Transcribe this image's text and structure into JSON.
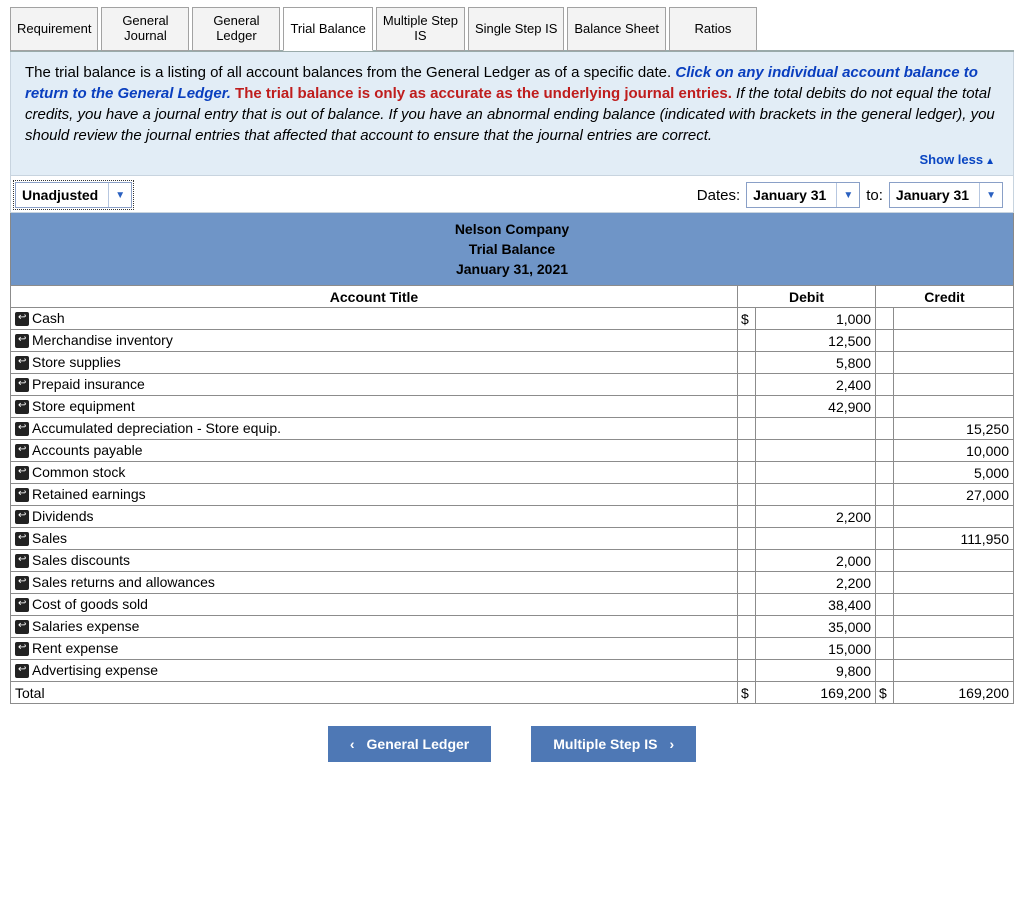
{
  "tabs": [
    {
      "label": "Requirement"
    },
    {
      "label": "General\nJournal"
    },
    {
      "label": "General\nLedger"
    },
    {
      "label": "Trial Balance",
      "active": true
    },
    {
      "label": "Multiple Step\nIS"
    },
    {
      "label": "Single Step IS"
    },
    {
      "label": "Balance Sheet"
    },
    {
      "label": "Ratios"
    }
  ],
  "info": {
    "part1": "The trial balance is a listing of all account balances from the General Ledger as of a specific date. ",
    "part2_blue": "Click on any individual account balance to return to the General Ledger. ",
    "part3_red": "The trial balance is only as accurate as the underlying journal entries. ",
    "part4_italic": "If the total debits do not equal the total credits, you have a journal entry that is out of balance. If you have an abnormal ending balance (indicated with brackets in the general ledger), you should review the journal entries that affected that account to ensure that the journal entries are correct.",
    "show_less": "Show less"
  },
  "controls": {
    "type": "Unadjusted",
    "dates_label": "Dates:",
    "date_from": "January 31",
    "to_label": "to:",
    "date_to": "January 31"
  },
  "report_header": {
    "company": "Nelson Company",
    "title": "Trial Balance",
    "date": "January 31, 2021"
  },
  "columns": {
    "account": "Account Title",
    "debit": "Debit",
    "credit": "Credit"
  },
  "rows": [
    {
      "title": "Cash",
      "debit": "1,000",
      "credit": "",
      "dollar_d": "$"
    },
    {
      "title": "Merchandise inventory",
      "debit": "12,500",
      "credit": ""
    },
    {
      "title": "Store supplies",
      "debit": "5,800",
      "credit": ""
    },
    {
      "title": "Prepaid insurance",
      "debit": "2,400",
      "credit": ""
    },
    {
      "title": "Store equipment",
      "debit": "42,900",
      "credit": ""
    },
    {
      "title": "Accumulated depreciation - Store equip.",
      "debit": "",
      "credit": "15,250"
    },
    {
      "title": "Accounts payable",
      "debit": "",
      "credit": "10,000"
    },
    {
      "title": "Common stock",
      "debit": "",
      "credit": "5,000"
    },
    {
      "title": "Retained earnings",
      "debit": "",
      "credit": "27,000"
    },
    {
      "title": "Dividends",
      "debit": "2,200",
      "credit": ""
    },
    {
      "title": "Sales",
      "debit": "",
      "credit": "111,950"
    },
    {
      "title": "Sales discounts",
      "debit": "2,000",
      "credit": ""
    },
    {
      "title": "Sales returns and allowances",
      "debit": "2,200",
      "credit": ""
    },
    {
      "title": "Cost of goods sold",
      "debit": "38,400",
      "credit": ""
    },
    {
      "title": "Salaries expense",
      "debit": "35,000",
      "credit": ""
    },
    {
      "title": "Rent expense",
      "debit": "15,000",
      "credit": ""
    },
    {
      "title": "Advertising expense",
      "debit": "9,800",
      "credit": ""
    }
  ],
  "total": {
    "label": "Total",
    "debit": "169,200",
    "credit": "169,200",
    "dollar_d": "$",
    "dollar_c": "$"
  },
  "nav": {
    "prev": "General Ledger",
    "next": "Multiple Step IS"
  },
  "chart_data": {
    "type": "table",
    "title": "Nelson Company Trial Balance January 31, 2021",
    "columns": [
      "Account Title",
      "Debit",
      "Credit"
    ],
    "rows": [
      [
        "Cash",
        1000,
        null
      ],
      [
        "Merchandise inventory",
        12500,
        null
      ],
      [
        "Store supplies",
        5800,
        null
      ],
      [
        "Prepaid insurance",
        2400,
        null
      ],
      [
        "Store equipment",
        42900,
        null
      ],
      [
        "Accumulated depreciation - Store equip.",
        null,
        15250
      ],
      [
        "Accounts payable",
        null,
        10000
      ],
      [
        "Common stock",
        null,
        5000
      ],
      [
        "Retained earnings",
        null,
        27000
      ],
      [
        "Dividends",
        2200,
        null
      ],
      [
        "Sales",
        null,
        111950
      ],
      [
        "Sales discounts",
        2000,
        null
      ],
      [
        "Sales returns and allowances",
        2200,
        null
      ],
      [
        "Cost of goods sold",
        38400,
        null
      ],
      [
        "Salaries expense",
        35000,
        null
      ],
      [
        "Rent expense",
        15000,
        null
      ],
      [
        "Advertising expense",
        9800,
        null
      ],
      [
        "Total",
        169200,
        169200
      ]
    ]
  }
}
